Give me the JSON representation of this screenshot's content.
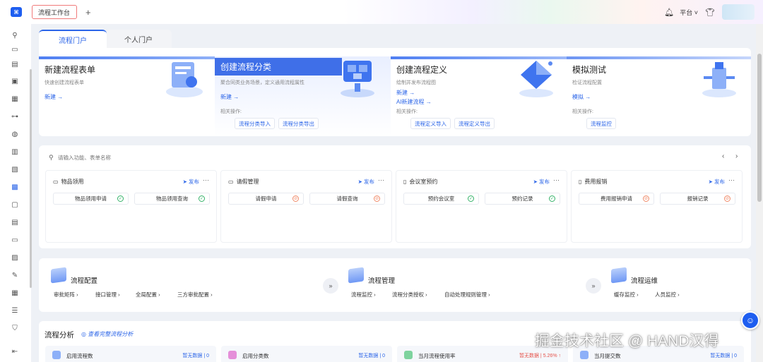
{
  "topbar": {
    "tab": "流程工作台",
    "plus": "+",
    "platform": "平台",
    "platform_caret": "˅"
  },
  "portal_tabs": [
    "流程门户",
    "个人门户"
  ],
  "banner_cards": [
    {
      "title": "新建流程表单",
      "sub": "快速创建流程表单",
      "links": [
        "新建 →"
      ],
      "related": "",
      "buttons": []
    },
    {
      "title": "创建流程分类",
      "sub": "聚合同类业务场景，定义通用流程属性",
      "links": [
        "新建 →"
      ],
      "related": "相关操作:",
      "buttons": [
        "流程分类导入",
        "流程分类导出"
      ]
    },
    {
      "title": "创建流程定义",
      "sub": "绘制并发布流程图",
      "links": [
        "新建 →",
        "AI新建流程 →"
      ],
      "related": "相关操作:",
      "buttons": [
        "流程定义导入",
        "流程定义导出"
      ]
    },
    {
      "title": "模拟测试",
      "sub": "检证流程配置",
      "links": [
        "模拟 →"
      ],
      "related": "相关操作:",
      "buttons": [
        "流程监控"
      ]
    }
  ],
  "search": {
    "placeholder": "请输入功能、表单名称",
    "prev": "‹",
    "next": "›"
  },
  "process_cards": [
    {
      "name": "物品领用",
      "publish": "发布",
      "more": "···",
      "items": [
        {
          "label": "物品领用申请",
          "status": "ok"
        },
        {
          "label": "物品领用查询",
          "status": "ok"
        }
      ]
    },
    {
      "name": "请假管理",
      "publish": "发布",
      "more": "···",
      "items": [
        {
          "label": "请假申请",
          "status": "no"
        },
        {
          "label": "请假查询",
          "status": "no"
        }
      ]
    },
    {
      "name": "会议室预约",
      "publish": "发布",
      "more": "···",
      "items": [
        {
          "label": "预约会议室",
          "status": "ok"
        },
        {
          "label": "预约记录",
          "status": "ok"
        }
      ]
    },
    {
      "name": "费用报销",
      "publish": "发布",
      "more": "···",
      "items": [
        {
          "label": "费用报销申请",
          "status": "no"
        },
        {
          "label": "报销记录",
          "status": "no"
        }
      ]
    }
  ],
  "config_groups": [
    {
      "title": "流程配置",
      "links": [
        "审批矩阵 ›",
        "接口管理 ›",
        "全局配置 ›",
        "三方审批配置 ›"
      ]
    },
    {
      "title": "流程管理",
      "links": [
        "流程监控 ›",
        "流程分类授权 ›",
        "自动处理规则管理 ›"
      ]
    },
    {
      "title": "流程运维",
      "links": [
        "缓存监控 ›",
        "人员监控 ›"
      ]
    }
  ],
  "config_arrow": "»",
  "analysis": {
    "title": "流程分析",
    "link": "查看完整流程分析",
    "stats": [
      {
        "label": "启用流程数",
        "value": "暂无数据 | 0"
      },
      {
        "label": "启用分类数",
        "value": "暂无数据 | 0"
      },
      {
        "label": "当月流程使用率",
        "value": "暂无数据 | 5.26% ↑"
      },
      {
        "label": "当月提交数",
        "value": "暂无数据 | 0"
      }
    ]
  },
  "watermark": "掘金技术社区 @ HAND汉得",
  "colors": {
    "accent": "#2b65e8",
    "ok": "#36b36a",
    "warn": "#f08b6a"
  },
  "icons": {
    "logo": "brand-logo-icon",
    "bell": "bell-icon",
    "shirt": "theme-shirt-icon",
    "search": "search-icon",
    "publish": "send-icon",
    "help": "help-chat-icon"
  }
}
